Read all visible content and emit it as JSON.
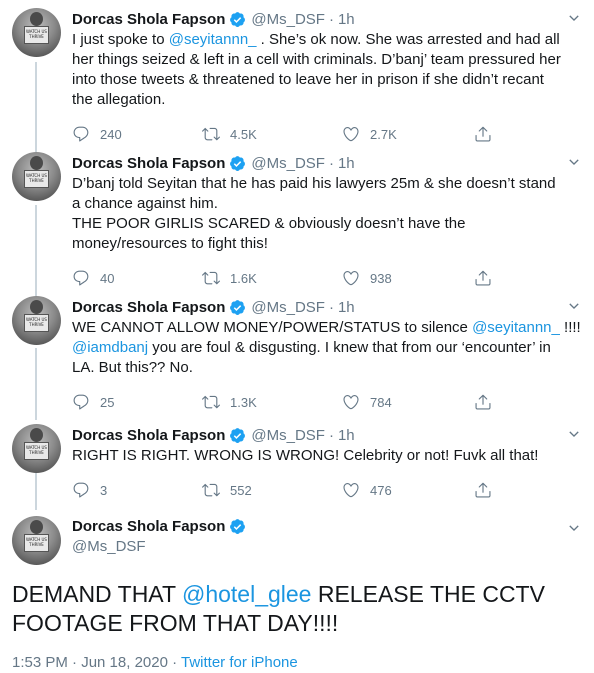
{
  "author": {
    "name": "Dorcas Shola Fapson",
    "handle": "@Ms_DSF",
    "avatar_sign_text": "WATCH US THRIVE"
  },
  "tweets": [
    {
      "time": "1h",
      "lines": [
        [
          {
            "t": "I just spoke to "
          },
          {
            "t": "@seyitannn_",
            "m": true
          },
          {
            "t": " . She’s ok now. She was arrested and had all"
          }
        ],
        [
          {
            "t": "her things seized & left in a cell with criminals. D’banj’ team pressured her"
          }
        ],
        [
          {
            "t": "into those tweets & threatened to leave her in prison if she didn’t recant"
          }
        ],
        [
          {
            "t": "the allegation."
          }
        ]
      ],
      "replies": "240",
      "retweets": "4.5K",
      "likes": "2.7K"
    },
    {
      "time": "1h",
      "lines": [
        [
          {
            "t": "D’banj told Seyitan that he has paid his lawyers 25m & she doesn’t stand"
          }
        ],
        [
          {
            "t": "a chance against him."
          }
        ],
        [
          {
            "t": "THE POOR GIRLIS SCARED & obviously doesn’t have the"
          }
        ],
        [
          {
            "t": "money/resources to fight this!"
          }
        ]
      ],
      "replies": "40",
      "retweets": "1.6K",
      "likes": "938"
    },
    {
      "time": "1h",
      "lines": [
        [
          {
            "t": "WE CANNOT ALLOW MONEY/POWER/STATUS to silence "
          },
          {
            "t": "@seyitannn_",
            "m": true
          },
          {
            "t": " !!!!"
          }
        ],
        [
          {
            "t": "@iamdbanj",
            "m": true
          },
          {
            "t": " you are foul & disgusting. I knew that from our ‘encounter’ in"
          }
        ],
        [
          {
            "t": "LA. But this?? No."
          }
        ]
      ],
      "replies": "25",
      "retweets": "1.3K",
      "likes": "784"
    },
    {
      "time": "1h",
      "lines": [
        [
          {
            "t": "RIGHT IS RIGHT. WRONG IS WRONG! Celebrity or not! Fuvk all that!"
          }
        ]
      ],
      "replies": "3",
      "retweets": "552",
      "likes": "476"
    }
  ],
  "main_tweet": {
    "lines": [
      [
        {
          "t": "DEMAND THAT "
        },
        {
          "t": "@hotel_glee",
          "m": true
        },
        {
          "t": " RELEASE THE CCTV"
        }
      ],
      [
        {
          "t": "FOOTAGE FROM THAT DAY!!!!"
        }
      ]
    ],
    "timestamp": "1:53 PM · Jun 18, 2020",
    "separator": " · ",
    "source": "Twitter for iPhone"
  },
  "colors": {
    "accent": "#1b95e0",
    "secondary_text": "#657786",
    "thread_line": "#ccd6dd"
  },
  "icons": {
    "reply": "reply-icon",
    "retweet": "retweet-icon",
    "like": "heart-icon",
    "share": "share-icon",
    "verified": "verified-badge-icon",
    "menu": "chevron-down-icon"
  }
}
